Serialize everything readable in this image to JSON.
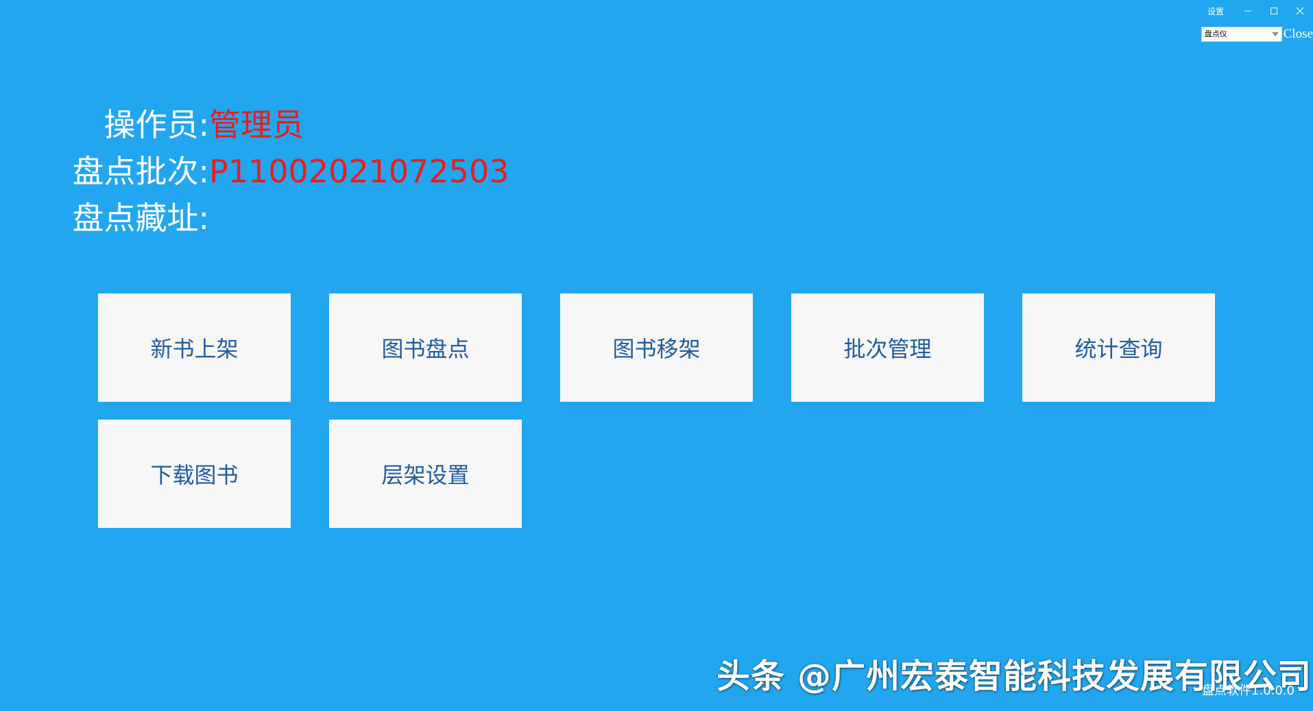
{
  "titlebar": {
    "settings_label": "设置",
    "minimize_icon": "minimize-icon",
    "maximize_icon": "maximize-icon",
    "close_icon": "close-icon"
  },
  "device": {
    "selected": "盘点仪",
    "close_label": "Close"
  },
  "info": {
    "operator_label": "操作员:",
    "operator_value": "管理员",
    "batch_label": "盘点批次:",
    "batch_value": "P11002021072503",
    "location_label": "盘点藏址:",
    "location_value": ""
  },
  "tiles": [
    {
      "label": "新书上架"
    },
    {
      "label": "图书盘点"
    },
    {
      "label": "图书移架"
    },
    {
      "label": "批次管理"
    },
    {
      "label": "统计查询"
    },
    {
      "label": "下载图书"
    },
    {
      "label": "层架设置"
    }
  ],
  "footer": {
    "watermark": "头条 @广州宏泰智能科技发展有限公司",
    "version": "盘点软件1.0.0.0"
  },
  "colors": {
    "background": "#22a6ef",
    "tile_bg": "#f7f7f8",
    "tile_text": "#1f5c9e",
    "value_red": "#f01a1a"
  }
}
